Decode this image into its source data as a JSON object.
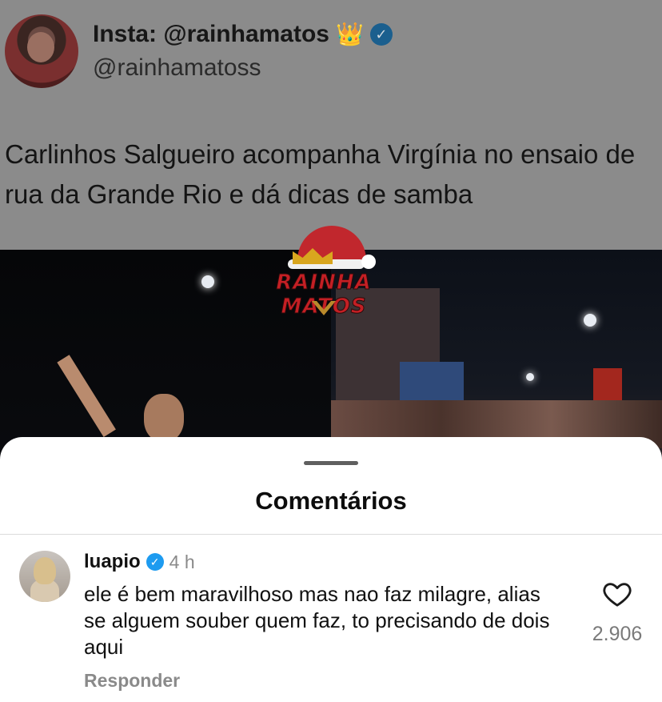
{
  "post": {
    "display_name": "Insta: @rainhamatos",
    "crown_emoji": "👑",
    "handle": "@rainhamatoss",
    "text": "Carlinhos Salgueiro acompanha Virgínia no ensaio de rua da Grande Rio e dá dicas de samba",
    "logo_text": "RAINHA MATOS"
  },
  "sheet": {
    "title": "Comentários"
  },
  "comment": {
    "username": "luapio",
    "time": "4 h",
    "text": "ele é bem maravilhoso mas nao faz milagre, alias se alguem souber quem faz, to precisando de dois aqui",
    "reply_label": "Responder",
    "likes": "2.906",
    "like_icon": "heart-outline-icon"
  },
  "colors": {
    "verified": "#1d9bf0",
    "sheet_bg": "#ffffff",
    "dim_overlay": "#8b8b8b"
  }
}
